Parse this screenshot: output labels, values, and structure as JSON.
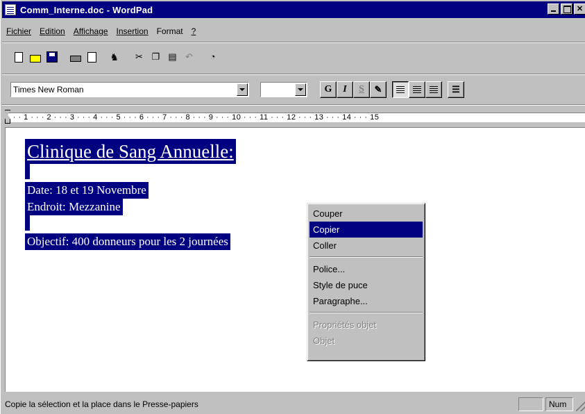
{
  "window": {
    "title": "Comm_Interne.doc - WordPad"
  },
  "menubar": {
    "items": [
      {
        "label": "Fichier"
      },
      {
        "label": "Edition"
      },
      {
        "label": "Affichage"
      },
      {
        "label": "Insertion"
      },
      {
        "label": "Format"
      },
      {
        "label": "?"
      }
    ]
  },
  "toolbar": {
    "buttons": [
      "new-icon",
      "open-icon",
      "save-icon",
      "print-icon",
      "print-preview-icon",
      "find-icon",
      "cut-icon",
      "copy-icon",
      "paste-icon",
      "undo-icon",
      "date-time-icon"
    ]
  },
  "formatbar": {
    "font_name": "Times New Roman",
    "font_size": "",
    "bold_label": "G",
    "italic_label": "I",
    "underline_label": "S",
    "align_left_pressed": true
  },
  "ruler": {
    "text": "· · · 1 · · · 2 · · · 3 · · · 4 · · · 5 · · · 6 · · · 7 · · · 8 · · · 9 · · · 10 · · · 11 · · · 12 · · · 13 · · · 14 · · · 15"
  },
  "document": {
    "heading": "Clinique de Sang Annuelle:",
    "line_date": "Date: 18 et 19 Novembre",
    "line_place": "Endroit: Mezzanine",
    "line_goal": "Objectif: 400 donneurs pour les 2 journées"
  },
  "context_menu": {
    "cut": "Couper",
    "copy": "Copier",
    "paste": "Coller",
    "font": "Police...",
    "bullet": "Style de puce",
    "paragraph": "Paragraphe...",
    "object_props": "Propriétés objet",
    "object": "Objet",
    "highlighted": "Copier"
  },
  "statusbar": {
    "message": "Copie la sélection et la place dans le Presse-papiers",
    "num": "Num"
  },
  "colors": {
    "titlebar": "#000080",
    "selection": "#000080",
    "chrome": "#c0c0c0"
  }
}
